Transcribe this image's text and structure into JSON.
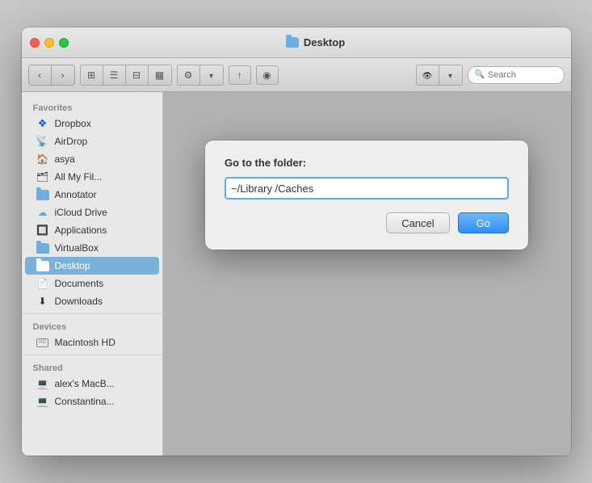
{
  "window": {
    "title": "Desktop"
  },
  "toolbar": {
    "search_placeholder": "Search",
    "search_value": ""
  },
  "sidebar": {
    "favorites_label": "Favorites",
    "devices_label": "Devices",
    "shared_label": "Shared",
    "items_favorites": [
      {
        "id": "dropbox",
        "label": "Dropbox",
        "icon": "dropbox"
      },
      {
        "id": "airdrop",
        "label": "AirDrop",
        "icon": "airdrop"
      },
      {
        "id": "asya",
        "label": "asya",
        "icon": "home"
      },
      {
        "id": "all-my-files",
        "label": "All My Fil...",
        "icon": "stack"
      },
      {
        "id": "annotator",
        "label": "Annotator",
        "icon": "folder"
      },
      {
        "id": "icloud-drive",
        "label": "iCloud Drive",
        "icon": "cloud"
      },
      {
        "id": "applications",
        "label": "Applications",
        "icon": "folder"
      },
      {
        "id": "virtualbox",
        "label": "VirtualBox",
        "icon": "folder"
      },
      {
        "id": "desktop",
        "label": "Desktop",
        "icon": "folder",
        "active": true
      },
      {
        "id": "documents",
        "label": "Documents",
        "icon": "folder"
      },
      {
        "id": "downloads",
        "label": "Downloads",
        "icon": "download"
      }
    ],
    "items_devices": [
      {
        "id": "macintosh-hd",
        "label": "Macintosh HD",
        "icon": "hd"
      }
    ],
    "items_shared": [
      {
        "id": "alexs-macbook",
        "label": "alex's MacB...",
        "icon": "computer"
      },
      {
        "id": "constantina",
        "label": "Constantina...",
        "icon": "computer"
      }
    ]
  },
  "modal": {
    "title": "Go to the folder:",
    "input_value": "~/Library /Caches",
    "cancel_label": "Cancel",
    "go_label": "Go"
  }
}
